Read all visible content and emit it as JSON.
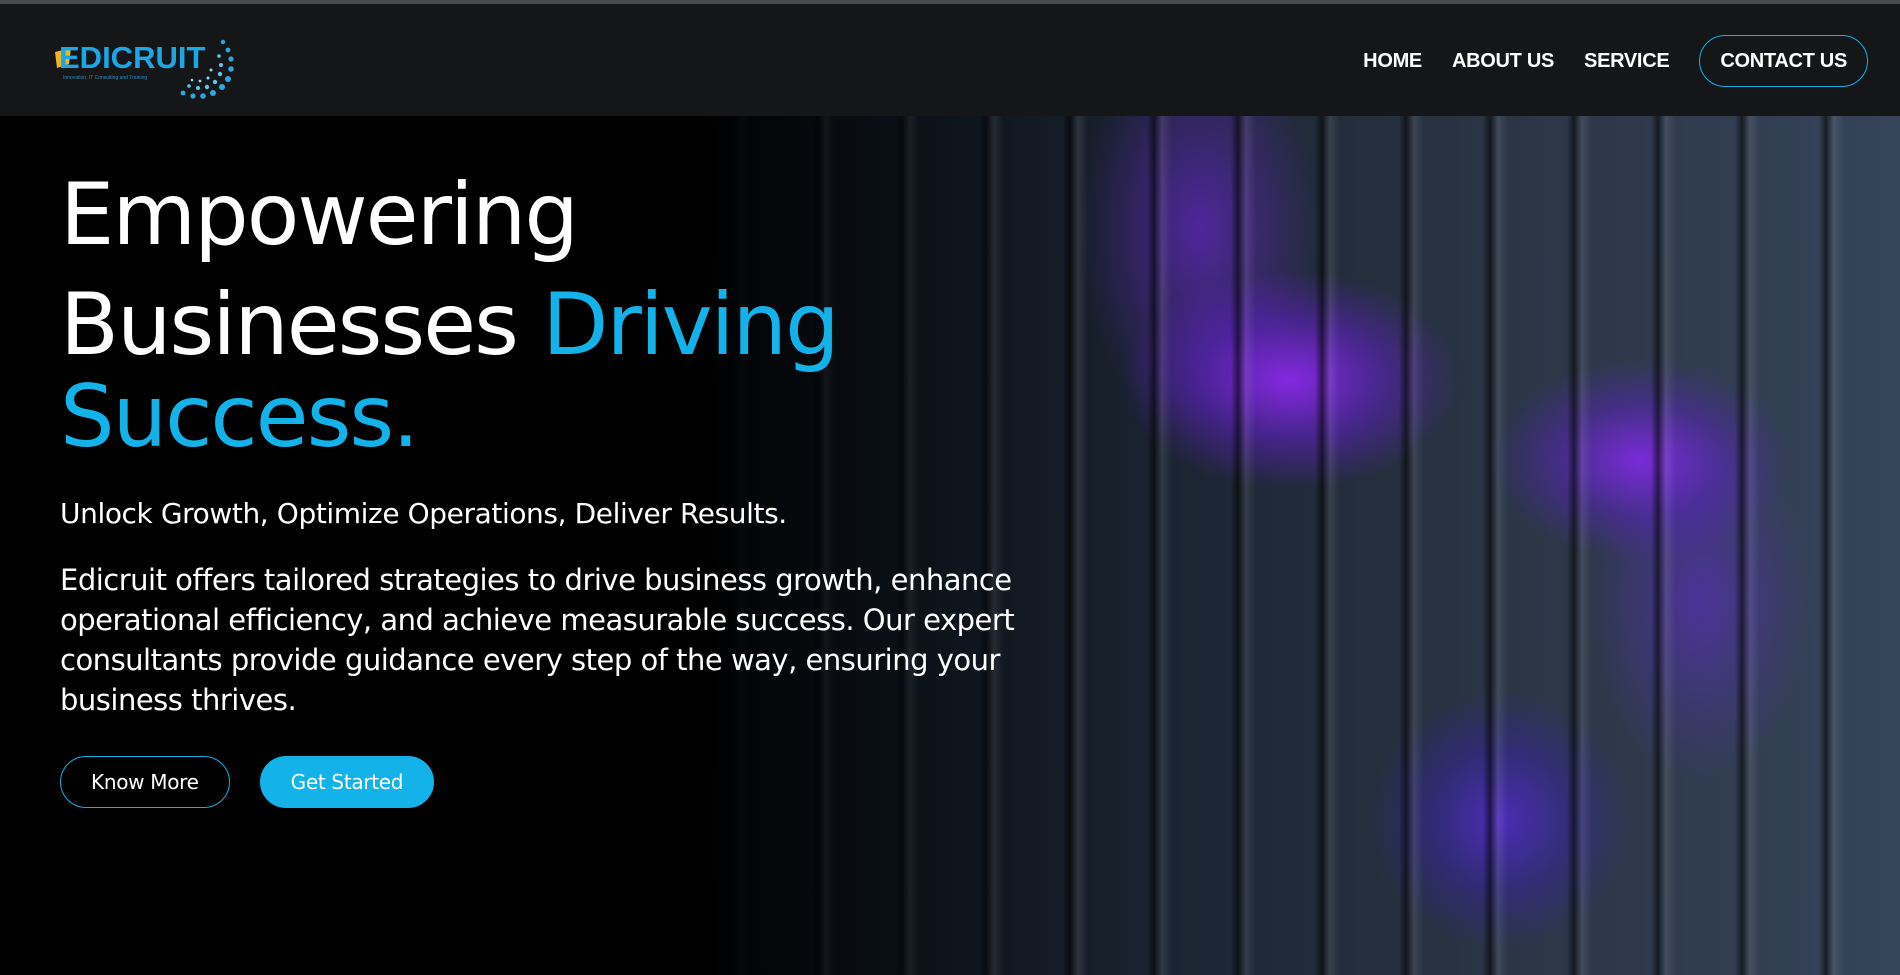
{
  "brand": {
    "logo_text": "EDICRUIT",
    "logo_tagline": "Innovation, IT Consulting and Training",
    "accent_color": "#13b3ea",
    "glow_color": "#8a2be2"
  },
  "nav": {
    "items": [
      {
        "label": "HOME"
      },
      {
        "label": "ABOUT US"
      },
      {
        "label": "SERVICE"
      }
    ],
    "contact_label": "CONTACT US"
  },
  "hero": {
    "headline_line1": "Empowering",
    "headline_line2": "Businesses ",
    "headline_accent1": "Driving",
    "headline_accent2": "Success.",
    "tagline": "Unlock Growth, Optimize Operations, Deliver Results.",
    "description": "Edicruit offers tailored strategies to drive business growth, enhance operational efficiency, and achieve measurable success. Our expert consultants provide guidance every step of the way, ensuring your business thrives.",
    "know_more_label": "Know More",
    "get_started_label": "Get Started"
  }
}
